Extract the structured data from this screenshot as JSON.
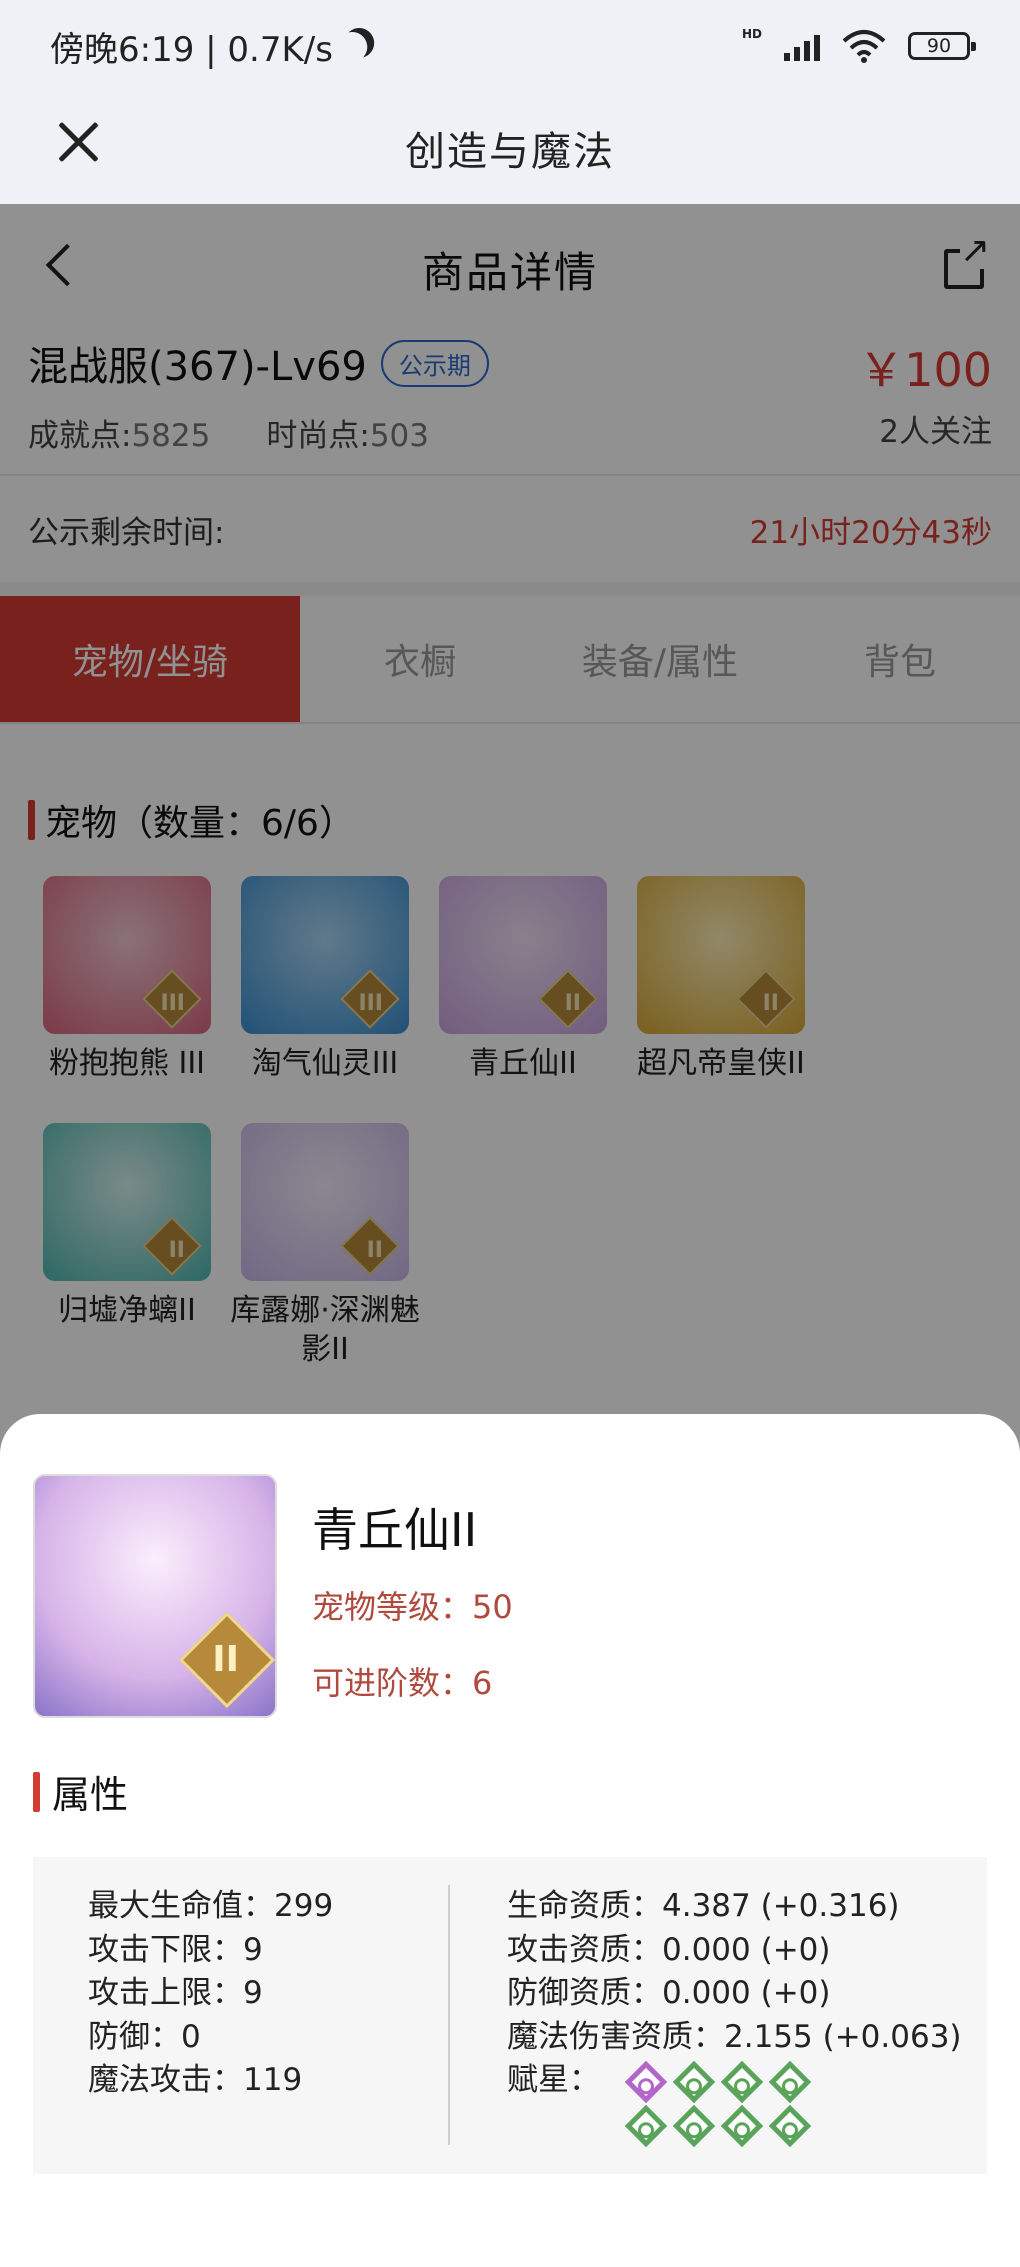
{
  "status_bar": {
    "time": "傍晚6:19 | 0.7K/s",
    "hd": "HD",
    "battery": "90"
  },
  "app_bar": {
    "title": "创造与魔法"
  },
  "detail": {
    "title": "商品详情",
    "product_name": "混战服(367)-Lv69",
    "badge": "公示期",
    "achievement_label": "成就点:",
    "achievement_value": "5825",
    "fashion_label": "时尚点:",
    "fashion_value": "503",
    "price": "￥100",
    "followers": "2人关注",
    "remaining_label": "公示剩余时间:",
    "remaining_value": "21小时20分43秒"
  },
  "tabs": [
    "宠物/坐骑",
    "衣橱",
    "装备/属性",
    "背包"
  ],
  "pets_section": {
    "title": "宠物（数量：6/6）",
    "items": [
      {
        "name": "粉抱抱熊 III",
        "tier": "III",
        "color": "#d9667e"
      },
      {
        "name": "淘气仙灵III",
        "tier": "III",
        "color": "#3b8fd1"
      },
      {
        "name": "青丘仙II",
        "tier": "II",
        "color": "#c9a3e0"
      },
      {
        "name": "超凡帝皇侠II",
        "tier": "II",
        "color": "#d6a833"
      },
      {
        "name": "归墟净螭II",
        "tier": "II",
        "color": "#4fb8b0"
      },
      {
        "name": "库露娜·深渊魅影II",
        "tier": "II",
        "color": "#c7b8e8"
      }
    ]
  },
  "sheet": {
    "name": "青丘仙II",
    "level": "宠物等级：50",
    "advance": "可进阶数：6",
    "attr_title": "属性",
    "left_attrs": [
      "最大生命值：299",
      "攻击下限：9",
      "攻击上限：9",
      "防御：0",
      "魔法攻击：119"
    ],
    "right_attrs": [
      "生命资质：4.387 (+0.316)",
      "攻击资质：0.000 (+0)",
      "防御资质：0.000 (+0)",
      "魔法伤害资质：2.155 (+0.063)",
      "赋星："
    ],
    "stars": [
      "purple",
      "green",
      "green",
      "green",
      "green",
      "green",
      "green",
      "green"
    ]
  }
}
